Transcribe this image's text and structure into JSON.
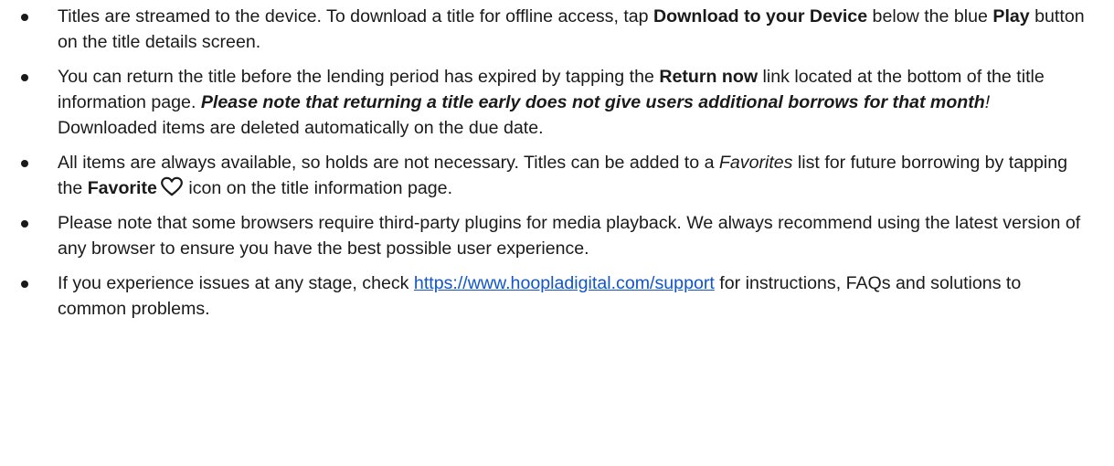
{
  "bullets": [
    {
      "t1": "Titles are streamed to the device. To download a title for offline access, tap ",
      "b1": "Download to your Device",
      "t2": " below the blue ",
      "b2": "Play",
      "t3": " button on the title details screen."
    },
    {
      "t1": "You can return the title before the lending period has expired by tapping the ",
      "b1": "Return now",
      "t2": " link located at the bottom of the title information page. ",
      "bi1": "Please note that returning a title early does not give users additional borrows for that month",
      "i1": "!",
      "t3": " Downloaded items are deleted automatically on the due date."
    },
    {
      "t1": "All items are always available, so holds are not necessary. Titles can be added to a ",
      "i1": "Favorites",
      "t2": " list for future borrowing by tapping the ",
      "b1": "Favorite",
      "icon": "heart-icon",
      "t3": " icon on the title information page."
    },
    {
      "t1": "Please note that some browsers require third-party plugins for media playback. We always recommend using the latest version of any browser to ensure you have the best possible user experience."
    },
    {
      "t1": "If you experience issues at any stage, check ",
      "link": "https://www.hoopladigital.com/support",
      "t2": " for instructions, FAQs and solutions to common problems."
    }
  ],
  "colors": {
    "text": "#1a1a1a",
    "link": "#1155cc"
  }
}
